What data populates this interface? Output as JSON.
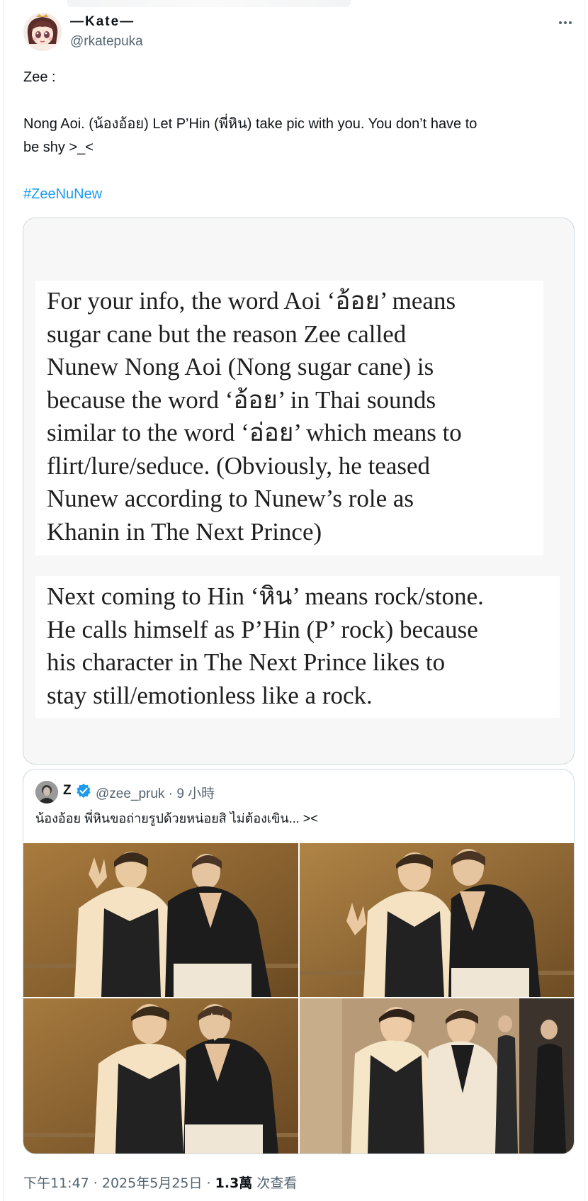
{
  "author": {
    "display_name": "—Kate—",
    "handle": "@rkatepuka"
  },
  "tweet": {
    "lines": [
      "Zee :",
      "",
      "Nong Aoi. (น้องอ้อย) Let P’Hin (พี่หิน) take pic with you. You don’t have to",
      "be shy >_<",
      ""
    ],
    "hashtag": "#ZeeNuNew"
  },
  "media_note": {
    "paragraph1": [
      "For your info, the word Aoi ‘อ้อย’ means",
      "sugar cane but the reason Zee called",
      "Nunew Nong Aoi (Nong sugar cane) is",
      "because the word ‘อ้อย’ in Thai sounds",
      "similar to the word ‘อ่อย’ which means to",
      "flirt/lure/seduce. (Obviously, he teased",
      "Nunew according to Nunew’s role as",
      "Khanin in The Next Prince)"
    ],
    "paragraph2": [
      "Next coming to Hin ‘หิน’ means rock/stone.",
      "He calls himself as P’Hin (P’ rock) because",
      "his character in The Next Prince likes to",
      "stay still/emotionless like a rock."
    ]
  },
  "quoted_tweet": {
    "name": "Z",
    "meta": "@zee_pruk · 9 小時",
    "text": "น้องอ้อย พี่หินขอถ่ายรูปด้วยหน่อยสิ ไม่ต้องเขิน... ><",
    "photo_count": 4
  },
  "footer": {
    "time": "下午11:47 · 2025年5月25日 · ",
    "views_count": "1.3萬",
    "views_label": " 次查看"
  },
  "colors": {
    "accent": "#1d9bf0",
    "text": "#0f1419",
    "secondary": "#536471",
    "border": "#cfd9de"
  },
  "icons": [
    "more-icon",
    "verified-icon"
  ]
}
